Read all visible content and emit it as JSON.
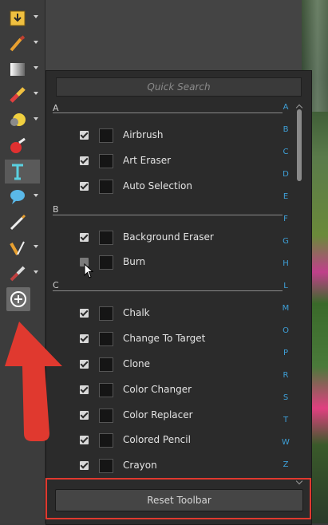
{
  "search": {
    "placeholder": "Quick Search"
  },
  "sections": [
    {
      "letter": "A",
      "items": [
        {
          "label": "Airbrush",
          "checked": true,
          "icon": "airbrush-icon"
        },
        {
          "label": "Art Eraser",
          "checked": true,
          "icon": "art-eraser-icon"
        },
        {
          "label": "Auto Selection",
          "checked": true,
          "icon": "auto-selection-icon"
        }
      ]
    },
    {
      "letter": "B",
      "items": [
        {
          "label": "Background Eraser",
          "checked": true,
          "icon": "background-eraser-icon"
        },
        {
          "label": "Burn",
          "checked": false,
          "icon": "burn-icon"
        }
      ]
    },
    {
      "letter": "C",
      "items": [
        {
          "label": "Chalk",
          "checked": true,
          "icon": "chalk-icon"
        },
        {
          "label": "Change To Target",
          "checked": true,
          "icon": "change-to-target-icon"
        },
        {
          "label": "Clone",
          "checked": true,
          "icon": "clone-icon"
        },
        {
          "label": "Color Changer",
          "checked": true,
          "icon": "color-changer-icon"
        },
        {
          "label": "Color Replacer",
          "checked": true,
          "icon": "color-replacer-icon"
        },
        {
          "label": "Colored Pencil",
          "checked": true,
          "icon": "colored-pencil-icon"
        },
        {
          "label": "Crayon",
          "checked": true,
          "icon": "crayon-icon"
        }
      ]
    }
  ],
  "alphabet": [
    "A",
    "B",
    "C",
    "D",
    "E",
    "F",
    "G",
    "H",
    "L",
    "M",
    "O",
    "P",
    "R",
    "S",
    "T",
    "W",
    "Z"
  ],
  "reset_label": "Reset Toolbar",
  "toolbar_tools": [
    "import-icon",
    "brush-icon",
    "gradient-icon",
    "eraser-icon",
    "dodge-icon",
    "paint-icon",
    "text-tool-icon",
    "speech-bubble-icon",
    "pen-icon",
    "dropper-brush-icon",
    "smudge-icon"
  ],
  "colors": {
    "accent": "#3ea0d8",
    "highlight": "#e0392f",
    "panel": "#2b2b2b"
  }
}
